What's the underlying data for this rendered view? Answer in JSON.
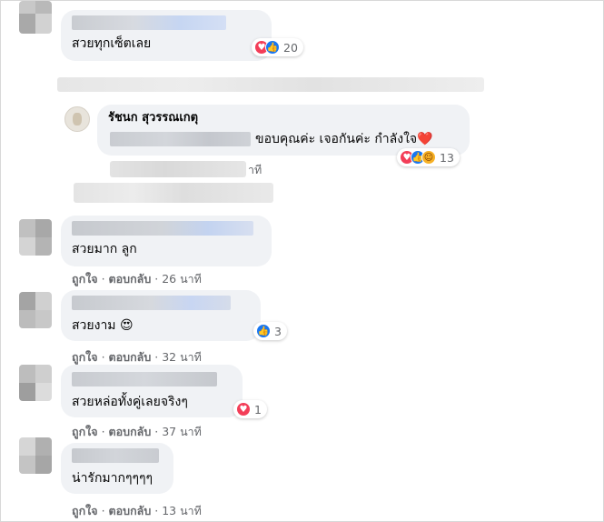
{
  "comments": [
    {
      "text": "สวยทุกเซ็ตเลย",
      "reaction_count": "20",
      "reaction_icons": [
        "heart-icon",
        "like-icon"
      ]
    },
    {
      "reply": true,
      "author": "รัชนก สุวรรณเกตุ",
      "text": "ขอบคุณค่ะ เจอกันค่ะ กำลังใจ",
      "text_emoji": "❤️",
      "reaction_count": "13",
      "reaction_icons": [
        "heart-icon",
        "like-icon",
        "care-icon"
      ],
      "meta_partial": "าที"
    },
    {
      "text": "สวยมาก ลูก",
      "like": "ถูกใจ",
      "reply": "ตอบกลับ",
      "time": "26 นาที"
    },
    {
      "text": "สวยงาม",
      "text_emoji": "😍",
      "reaction_count": "3",
      "reaction_icons": [
        "like-icon"
      ],
      "like": "ถูกใจ",
      "reply": "ตอบกลับ",
      "time": "32 นาที"
    },
    {
      "text": "สวยหล่อทั้งคู่เลยจริงๆ",
      "reaction_count": "1",
      "reaction_icons": [
        "heart-icon"
      ],
      "like": "ถูกใจ",
      "reply": "ตอบกลับ",
      "time": "37 นาที"
    },
    {
      "text": "น่ารักมากๆๆๆๆ",
      "like": "ถูกใจ",
      "reply": "ตอบกลับ",
      "time": "13 นาที"
    }
  ],
  "ui": {
    "separator": "·"
  },
  "colors": {
    "bubble": "#f0f2f5",
    "love": "#f33e58",
    "like": "#1877f2",
    "meta_text": "#65676b"
  }
}
